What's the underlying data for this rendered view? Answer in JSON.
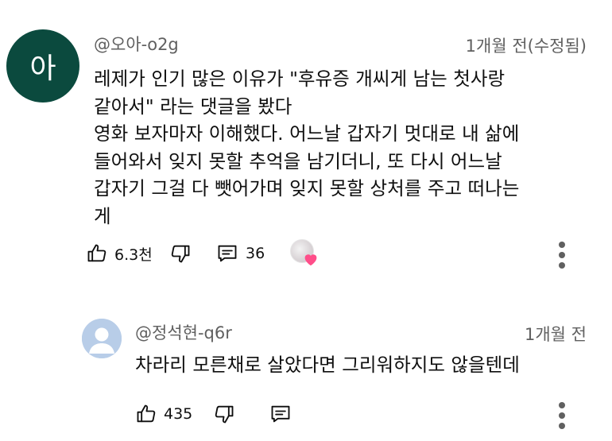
{
  "comments": [
    {
      "avatar_letter": "아",
      "avatar_color": "#0b4a3e",
      "username": "@오아-o2g",
      "timestamp": "1개월 전(수정됨)",
      "text": "레제가 인기 많은 이유가 \"후유증 개씨게 남는 첫사랑\n같아서\" 라는 댓글을 봤다\n영화 보자마자 이해했다. 어느날 갑자기 멋대로 내 삶에\n들어와서 잊지 못할 추억을 남기더니, 또 다시 어느날\n갑자기 그걸 다 뺏어가며 잊지 못할 상처를 주고 떠나는\n게",
      "likes": "6.3천",
      "replies": "36",
      "creator_heart": true,
      "icons": [
        "thumb-up-icon",
        "thumb-down-icon",
        "reply-icon",
        "creator-heart-icon",
        "more-vert-icon"
      ]
    },
    {
      "avatar_color": "#b8cde8",
      "username": "@정석현-q6r",
      "timestamp": "1개월 전",
      "text": "차라리 모른채로 살았다면 그리워하지도 않을텐데",
      "likes": "435",
      "icons": [
        "thumb-up-icon",
        "thumb-down-icon",
        "reply-icon",
        "more-vert-icon"
      ]
    }
  ],
  "colors": {
    "text": "#0f0f0f",
    "meta": "#606060",
    "heart": "#ff4e8a"
  }
}
